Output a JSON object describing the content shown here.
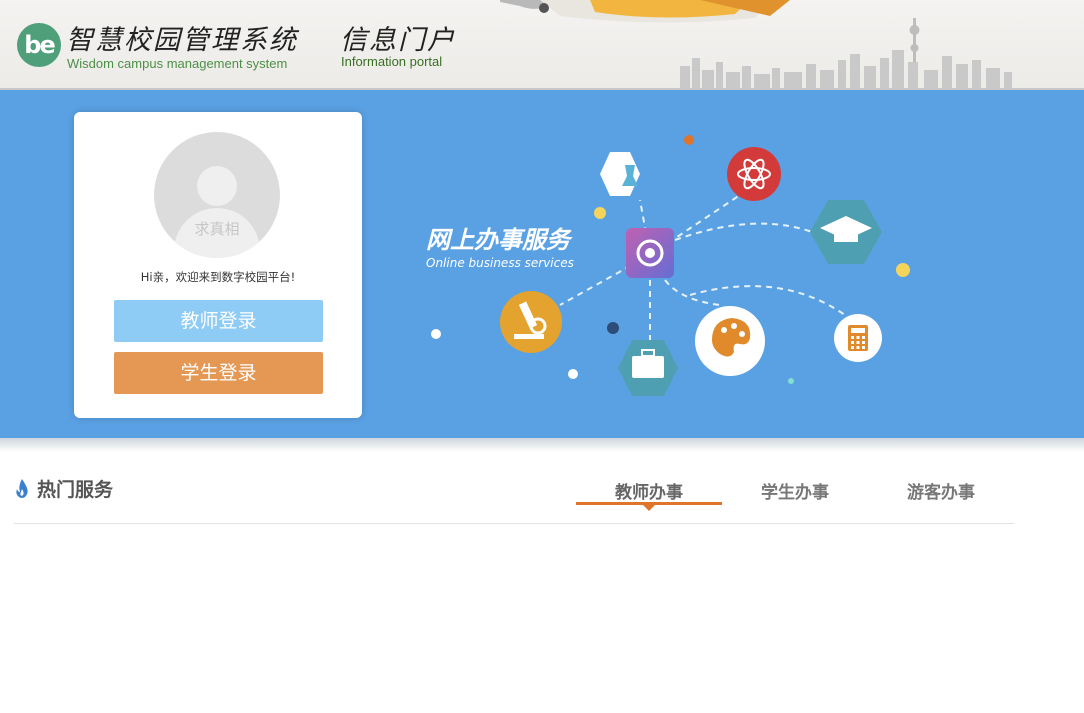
{
  "header": {
    "logo_text": "be",
    "system_title": "智慧校园管理系统",
    "system_subtitle": "Wisdom campus management system",
    "portal_title": "信息门户",
    "portal_subtitle": "Information portal"
  },
  "login": {
    "avatar_caption": "求真相",
    "welcome": "Hi亲，欢迎来到数字校园平台!",
    "teacher_button": "教师登录",
    "student_button": "学生登录"
  },
  "banner": {
    "title": "网上办事服务",
    "subtitle": "Online business services"
  },
  "services": {
    "title": "热门服务",
    "tabs": [
      {
        "label": "教师办事",
        "active": true
      },
      {
        "label": "学生办事",
        "active": false
      },
      {
        "label": "游客办事",
        "active": false
      }
    ]
  },
  "colors": {
    "banner_bg": "#5aa1e4",
    "teacher_btn": "#8ecbf5",
    "student_btn": "#e49854",
    "active_tab": "#e0742a"
  }
}
